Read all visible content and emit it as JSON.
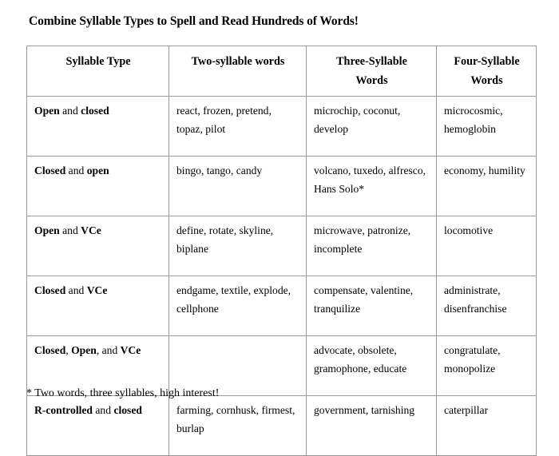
{
  "document": {
    "title": "Combine Syllable Types to Spell and Read Hundreds of Words!",
    "footnote": "* Two words, three syllables, high interest!"
  },
  "table": {
    "headers": [
      "Syllable Type",
      "Two-syllable words",
      "Three-Syllable Words",
      "Four-Syllable Words"
    ],
    "headers_lines": [
      [
        "Syllable Type"
      ],
      [
        "Two-syllable words"
      ],
      [
        "Three-Syllable",
        "Words"
      ],
      [
        "Four-Syllable",
        "Words"
      ]
    ],
    "rows": [
      {
        "type_html": "<b>Open</b> and <b>closed</b>",
        "type_text": "Open and closed",
        "two": "react, frozen, pretend, topaz, pilot",
        "three": "microchip, coconut, develop",
        "four": "microcosmic, hemoglobin"
      },
      {
        "type_html": "<b>Closed</b> and <b>open</b>",
        "type_text": "Closed and open",
        "two": "bingo, tango, candy",
        "three": "volcano, tuxedo, alfresco, Hans Solo*",
        "four": "economy, humility"
      },
      {
        "type_html": "<b>Open</b> and <b>VCe</b>",
        "type_text": "Open and VCe",
        "two": "define, rotate, skyline, biplane",
        "three": "microwave, patronize, incomplete",
        "four": "locomotive"
      },
      {
        "type_html": "<b>Closed</b> and <b>VCe</b>",
        "type_text": "Closed and VCe",
        "two": "endgame, textile, explode, cellphone",
        "three": "compensate, valentine, tranquilize",
        "four": "administrate, disenfranchise"
      },
      {
        "type_html": "<b>Closed</b>, <b>Open</b>, and <b>VCe</b>",
        "type_text": "Closed, Open, and VCe",
        "two": "",
        "three": "advocate, obsolete, gramophone, educate",
        "four": "congratulate, monopolize"
      },
      {
        "type_html": "<b>R-controlled</b> and <b>closed</b>",
        "type_text": "R-controlled and closed",
        "two": "farming, cornhusk, firmest, burlap",
        "three": "government, tarnishing",
        "four": "caterpillar"
      }
    ]
  },
  "colors": {
    "border": "#9a9a9a",
    "text": "#000000",
    "background": "#ffffff"
  }
}
